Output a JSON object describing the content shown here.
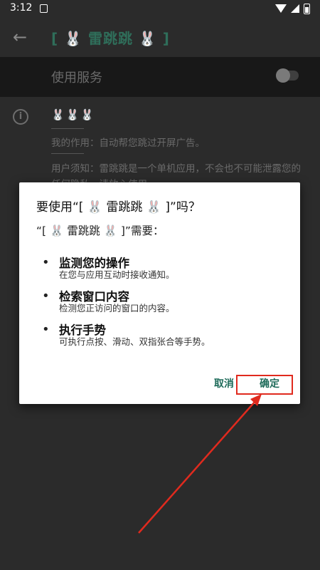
{
  "status_bar": {
    "time": "3:12"
  },
  "app_bar": {
    "title": "[ 🐰 雷跳跳 🐰 ]"
  },
  "service": {
    "label": "使用服务",
    "enabled": false
  },
  "info": {
    "emojis": "🐰🐰🐰",
    "purpose": "我的作用：自动帮您跳过开屏广告。",
    "notice": "用户须知：雷跳跳是一个单机应用，不会也不可能泄露您的任何隐私，请放心使用。"
  },
  "dialog": {
    "title": "要使用“[ 🐰 雷跳跳 🐰 ]”吗？",
    "subtitle": "“[ 🐰 雷跳跳 🐰 ]”需要：",
    "permissions": [
      {
        "title": "监测您的操作",
        "desc": "在您与应用互动时接收通知。"
      },
      {
        "title": "检索窗口内容",
        "desc": "检测您正访问的窗口的内容。"
      },
      {
        "title": "执行手势",
        "desc": "可执行点按、滑动、双指张合等手势。"
      }
    ],
    "cancel_label": "取消",
    "confirm_label": "确定"
  },
  "annotation_color": "#e02a1e",
  "accent_color": "#1e6b5a"
}
